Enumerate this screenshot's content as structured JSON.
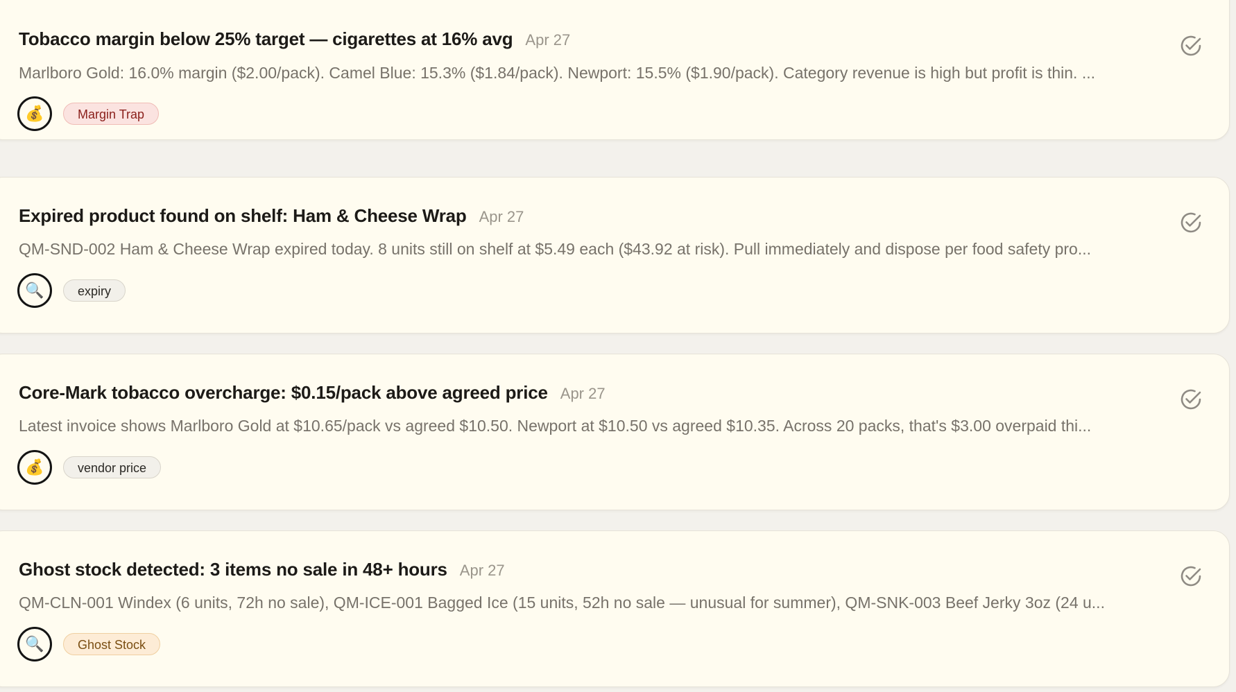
{
  "alerts": [
    {
      "title": "Tobacco margin below 25% target — cigarettes at 16% avg",
      "date": "Apr 27",
      "description": "Marlboro Gold: 16.0% margin ($2.00/pack). Camel Blue: 15.3% ($1.84/pack). Newport: 15.5% ($1.90/pack). Category revenue is high but profit is thin. ...",
      "icon": "money-bag-icon",
      "icon_glyph": "💰",
      "tag": "Margin Trap"
    },
    {
      "title": "Expired product found on shelf: Ham & Cheese Wrap",
      "date": "Apr 27",
      "description": "QM-SND-002 Ham & Cheese Wrap expired today. 8 units still on shelf at $5.49 each ($43.92 at risk). Pull immediately and dispose per food safety pro...",
      "icon": "magnifier-icon",
      "icon_glyph": "🔍",
      "tag": "expiry"
    },
    {
      "title": "Core-Mark tobacco overcharge: $0.15/pack above agreed price",
      "date": "Apr 27",
      "description": "Latest invoice shows Marlboro Gold at $10.65/pack vs agreed $10.50. Newport at $10.50 vs agreed $10.35. Across 20 packs, that's $3.00 overpaid thi...",
      "icon": "money-bag-icon",
      "icon_glyph": "💰",
      "tag": "vendor price"
    },
    {
      "title": "Ghost stock detected: 3 items no sale in 48+ hours",
      "date": "Apr 27",
      "description": "QM-CLN-001 Windex (6 units, 72h no sale), QM-ICE-001 Bagged Ice (15 units, 52h no sale — unusual for summer), QM-SNK-003 Beef Jerky 3oz (24 u...",
      "icon": "magnifier-icon",
      "icon_glyph": "🔍",
      "tag": "Ghost Stock"
    }
  ],
  "colors": {
    "card_bg": "#fffcf0",
    "page_bg": "#f3f1ec",
    "tag_margin_trap": "#fbe3e0",
    "tag_ghost_stock": "#fdecd6",
    "tag_neutral": "#f2f0ea",
    "check_gray": "#8f8b84"
  }
}
